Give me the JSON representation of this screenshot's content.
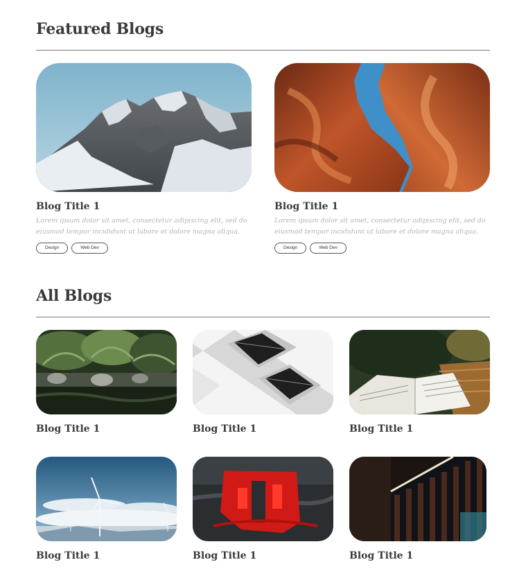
{
  "featured": {
    "heading": "Featured Blogs",
    "posts": [
      {
        "title": "Blog Title 1",
        "excerpt": "Lorem ipsum dolor sit amet, consectetur adipiscing elit, sed do eiusmod tempor incididunt ut labore et dolore magna aliqua.",
        "tags": [
          "Design",
          "Web Dev"
        ],
        "image": "snowy-mountain-photo"
      },
      {
        "title": "Blog Title 1",
        "excerpt": "Lorem ipsum dolor sit amet, consectetur adipiscing elit, sed do eiusmod tempor incididunt ut labore et dolore magna aliqua.",
        "tags": [
          "Design",
          "Web Dev"
        ],
        "image": "red-canyon-photo"
      }
    ]
  },
  "all": {
    "heading": "All Blogs",
    "posts": [
      {
        "title": "Blog Title 1",
        "image": "fern-river-photo"
      },
      {
        "title": "Blog Title 1",
        "image": "building-balconies-photo"
      },
      {
        "title": "Blog Title 1",
        "image": "open-book-photo"
      },
      {
        "title": "Blog Title 1",
        "image": "wind-turbines-photo"
      },
      {
        "title": "Blog Title 1",
        "image": "red-reflection-photo"
      },
      {
        "title": "Blog Title 1",
        "image": "dark-wall-light-photo"
      }
    ]
  }
}
